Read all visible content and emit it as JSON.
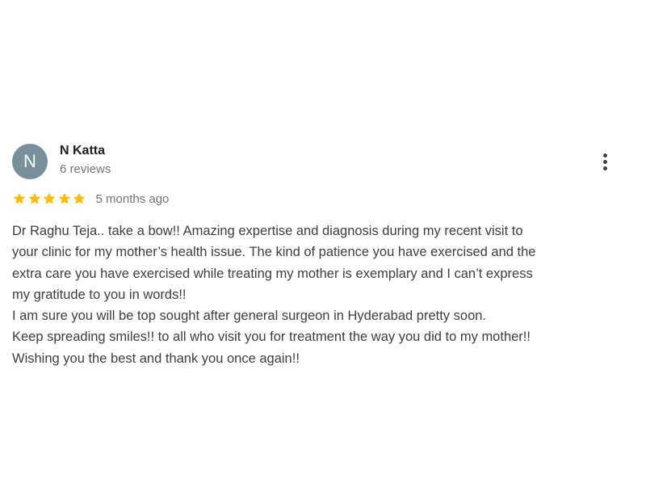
{
  "review": {
    "avatar_initial": "N",
    "avatar_color": "#78909c",
    "reviewer_name": "N Katta",
    "review_count": "6 reviews",
    "rating": 5,
    "rating_max": 5,
    "star_color": "#fbbc04",
    "star_icon": "star-icon",
    "more_icon": "more-vert-icon",
    "time_ago": "5 months ago",
    "text_lines": [
      "Dr Raghu Teja.. take a bow!! Amazing expertise and diagnosis during my recent visit to",
      "your clinic for my mother’s health issue. The kind of patience you have exercised and the",
      "extra care you have exercised while treating my mother is exemplary and I can’t express",
      "my gratitude to you in words!!",
      "I am sure you will be top sought after general surgeon in Hyderabad pretty soon.",
      "Keep spreading smiles!! to all who visit you for treatment the way you did to my mother!!",
      "Wishing you the best and thank you once again!!"
    ]
  }
}
